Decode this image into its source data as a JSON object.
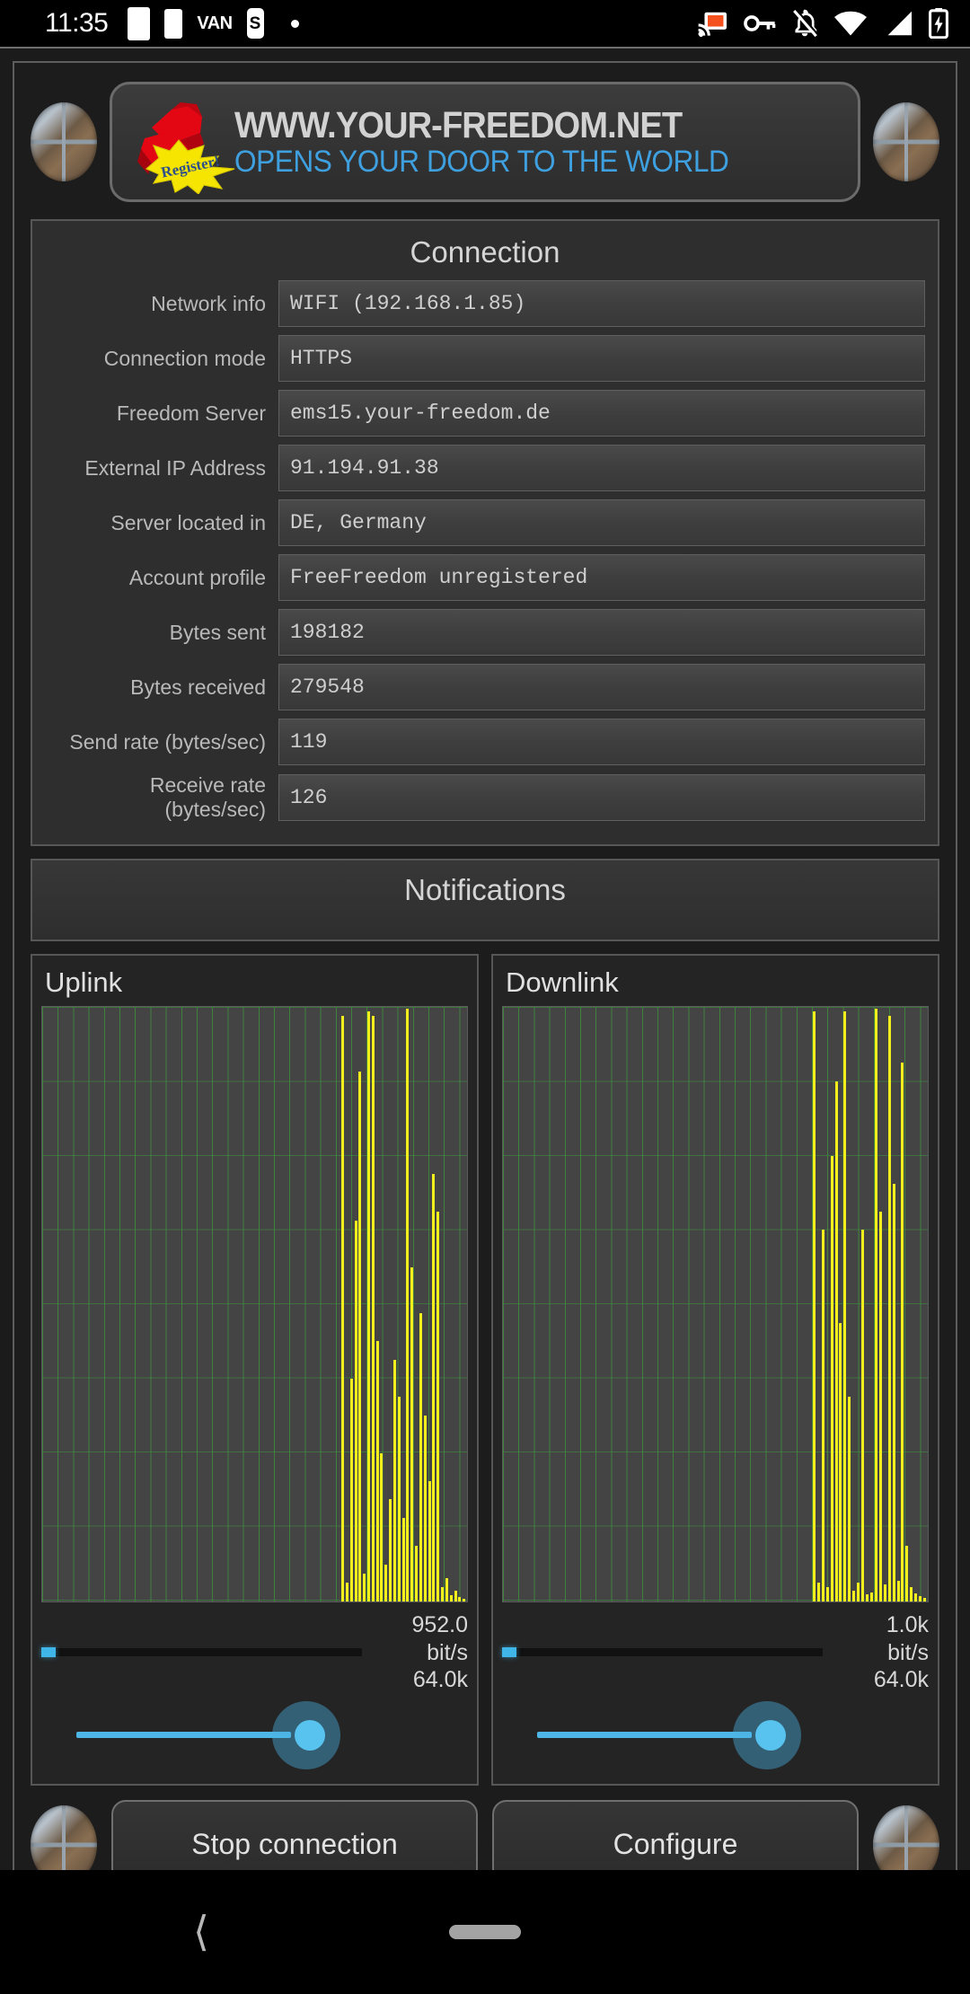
{
  "statusbar": {
    "time": "11:35",
    "left_icons": [
      "white-square-icon",
      "white-square-narrow-icon",
      "vpn-icon",
      "es-icon",
      "dot-icon"
    ],
    "vpn_label": "VAN",
    "es_label": "S",
    "right_icons": [
      "cast-icon",
      "vpn-key-icon",
      "notifications-off-icon",
      "wifi-icon",
      "cellular-signal-icon",
      "battery-charging-icon"
    ]
  },
  "banner": {
    "left_logo_icon": "porthole-window-icon",
    "right_logo_icon": "porthole-window-icon",
    "fist_icon": "red-fist-icon",
    "starburst_icon": "yellow-starburst-icon",
    "register_label": "Register!",
    "title": "WWW.YOUR-FREEDOM.NET",
    "subtitle": "OPENS YOUR DOOR TO THE WORLD",
    "title_color": "#d2d2d2",
    "subtitle_color": "#3fa0e0"
  },
  "connection": {
    "title": "Connection",
    "rows": [
      {
        "label": "Network info",
        "value": "WIFI (192.168.1.85)"
      },
      {
        "label": "Connection mode",
        "value": "HTTPS"
      },
      {
        "label": "Freedom Server",
        "value": "ems15.your-freedom.de"
      },
      {
        "label": "External IP Address",
        "value": "91.194.91.38"
      },
      {
        "label": "Server located in",
        "value": "DE, Germany"
      },
      {
        "label": "Account profile",
        "value": "FreeFreedom unregistered"
      },
      {
        "label": "Bytes sent",
        "value": "198182"
      },
      {
        "label": "Bytes received",
        "value": "279548"
      },
      {
        "label": "Send rate (bytes/sec)",
        "value": "119"
      },
      {
        "label": "Receive rate (bytes/sec)",
        "value": "126"
      }
    ]
  },
  "notifications": {
    "title": "Notifications",
    "items": []
  },
  "chart_data": [
    {
      "type": "bar",
      "title": "Uplink",
      "xlabel": "",
      "ylabel": "",
      "ylim": [
        0,
        64000
      ],
      "grid": true,
      "bar_color": "#f2ef1c",
      "plot_bg": "#444444",
      "grid_color": "#3c963c",
      "current_rate": "952.0",
      "rate_unit": "bit/s",
      "scale_max": "64.0k",
      "values": [
        0,
        0,
        0,
        0,
        0,
        0,
        0,
        0,
        0,
        0,
        0,
        0,
        0,
        0,
        0,
        0,
        0,
        0,
        0,
        0,
        0,
        0,
        0,
        0,
        0,
        0,
        0,
        0,
        0,
        0,
        0,
        0,
        0,
        0,
        0,
        0,
        0,
        0,
        0,
        0,
        0,
        0,
        0,
        0,
        0,
        0,
        0,
        0,
        0,
        0,
        0,
        0,
        0,
        0,
        0,
        0,
        0,
        0,
        0,
        0,
        0,
        0,
        0,
        0,
        0,
        0,
        0,
        0,
        0,
        63000,
        2000,
        24000,
        41000,
        57000,
        3000,
        63500,
        63000,
        28000,
        16000,
        4000,
        11000,
        26000,
        22000,
        9000,
        63800,
        36000,
        6000,
        31000,
        20000,
        13000,
        46000,
        42000,
        1500,
        2500,
        700,
        1200,
        500,
        300
      ]
    },
    {
      "type": "bar",
      "title": "Downlink",
      "xlabel": "",
      "ylabel": "",
      "ylim": [
        0,
        64000
      ],
      "grid": true,
      "bar_color": "#f2ef1c",
      "plot_bg": "#444444",
      "grid_color": "#3c963c",
      "current_rate": "1.0k",
      "rate_unit": "bit/s",
      "scale_max": "64.0k",
      "values": [
        0,
        0,
        0,
        0,
        0,
        0,
        0,
        0,
        0,
        0,
        0,
        0,
        0,
        0,
        0,
        0,
        0,
        0,
        0,
        0,
        0,
        0,
        0,
        0,
        0,
        0,
        0,
        0,
        0,
        0,
        0,
        0,
        0,
        0,
        0,
        0,
        0,
        0,
        0,
        0,
        0,
        0,
        0,
        0,
        0,
        0,
        0,
        0,
        0,
        0,
        0,
        0,
        0,
        0,
        0,
        0,
        0,
        0,
        0,
        0,
        0,
        0,
        0,
        0,
        0,
        0,
        0,
        0,
        0,
        0,
        63500,
        2000,
        40000,
        1500,
        48000,
        56000,
        30000,
        63500,
        22000,
        1200,
        2000,
        40000,
        800,
        1000,
        63800,
        42000,
        1800,
        63000,
        45000,
        2200,
        58000,
        6000,
        1500,
        900,
        600,
        400
      ]
    }
  ],
  "sliders": {
    "uplink": {
      "name": "uplink-rate-slider",
      "value_percent": 79
    },
    "downlink": {
      "name": "downlink-rate-slider",
      "value_percent": 79
    }
  },
  "buttons": {
    "stop_connection": "Stop connection",
    "configure": "Configure"
  },
  "navbar": {
    "back_icon": "back-chevron-icon",
    "home_icon": "home-pill-icon"
  }
}
